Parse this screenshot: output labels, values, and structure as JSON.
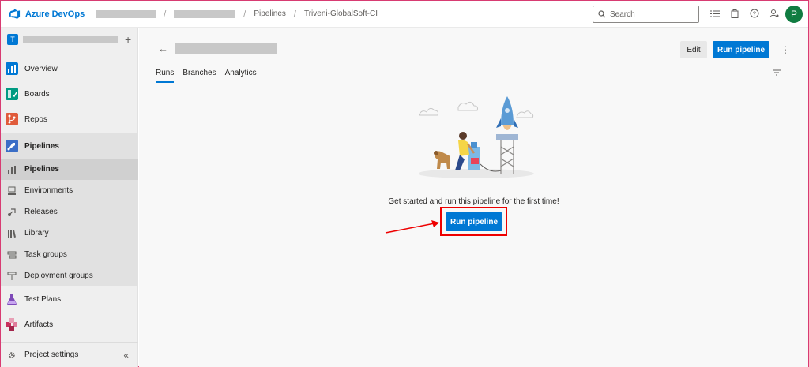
{
  "header": {
    "brand": "Azure DevOps",
    "crumbs": [
      "Pipelines",
      "Triveni-GlobalSoft-CI"
    ],
    "search_placeholder": "Search",
    "avatar_initial": "P"
  },
  "sidebar": {
    "project_initial": "T",
    "items": [
      {
        "label": "Overview",
        "icon": "overview-icon",
        "color": "#0078d4"
      },
      {
        "label": "Boards",
        "icon": "boards-icon",
        "color": "#009b82"
      },
      {
        "label": "Repos",
        "icon": "repos-icon",
        "color": "#e05b3b"
      },
      {
        "label": "Pipelines",
        "icon": "pipelines-icon",
        "color": "#3b6ec6"
      }
    ],
    "sub_items": [
      {
        "label": "Pipelines",
        "icon": "pipelines-sub-icon"
      },
      {
        "label": "Environments",
        "icon": "environments-icon"
      },
      {
        "label": "Releases",
        "icon": "releases-icon"
      },
      {
        "label": "Library",
        "icon": "library-icon"
      },
      {
        "label": "Task groups",
        "icon": "task-groups-icon"
      },
      {
        "label": "Deployment groups",
        "icon": "deployment-groups-icon"
      }
    ],
    "bottom_items": [
      {
        "label": "Test Plans",
        "icon": "test-plans-icon",
        "color": "#7e4ab8"
      },
      {
        "label": "Artifacts",
        "icon": "artifacts-icon",
        "color": "#c9305e"
      }
    ],
    "footer_label": "Project settings"
  },
  "main": {
    "edit_label": "Edit",
    "run_label": "Run pipeline",
    "tabs": [
      "Runs",
      "Branches",
      "Analytics"
    ],
    "active_tab": "Runs",
    "empty_message": "Get started and run this pipeline for the first time!",
    "center_run_label": "Run pipeline"
  },
  "colors": {
    "accent": "#0078d4",
    "highlight": "#e00000",
    "avatar": "#107c41"
  }
}
